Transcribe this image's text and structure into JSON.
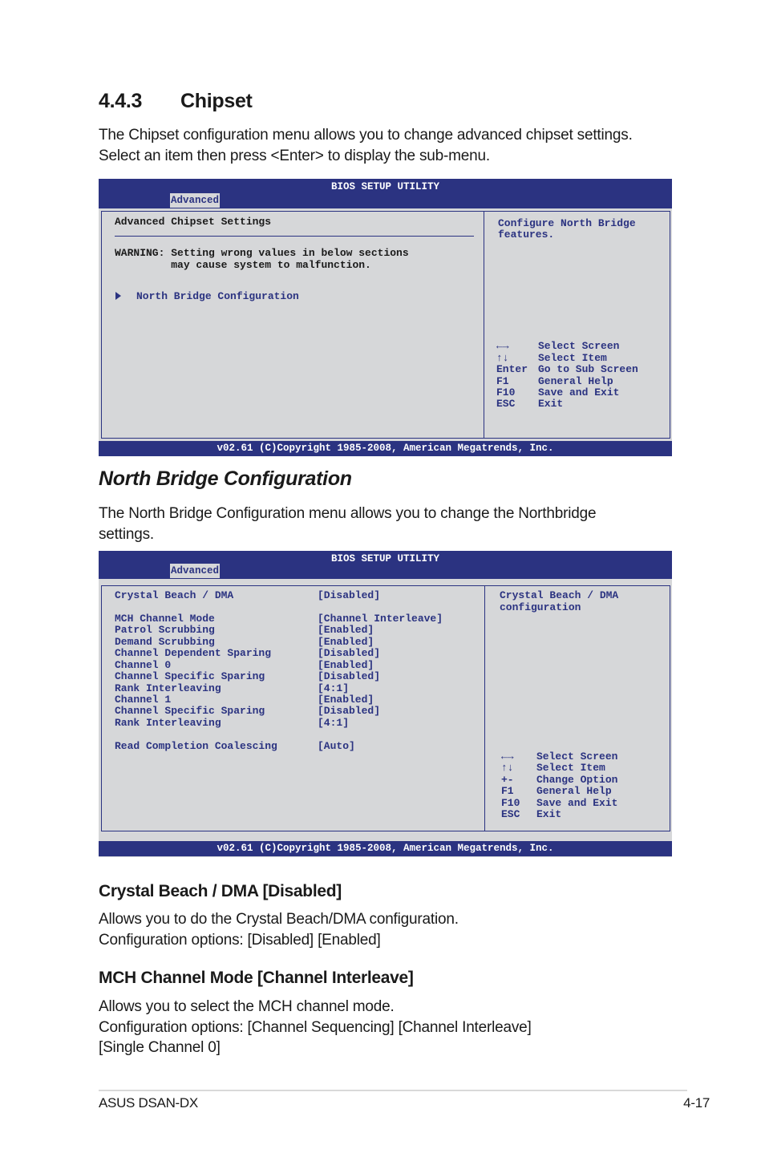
{
  "section": {
    "number": "4.4.3",
    "title": "Chipset"
  },
  "intro": {
    "line1": "The Chipset configuration menu allows you to change advanced chipset settings.",
    "line2": "Select an item then press <Enter> to display the sub-menu."
  },
  "bios1": {
    "title": "BIOS SETUP UTILITY",
    "tab": "Advanced",
    "heading": "Advanced Chipset Settings",
    "warning_line1": "WARNING: Setting wrong values in below sections",
    "warning_line2": "         may cause system to malfunction.",
    "submenu_item": "North Bridge Configuration",
    "help_line1": "Configure North Bridge",
    "help_line2": "features.",
    "keys": [
      {
        "key": "←→",
        "action": "Select Screen"
      },
      {
        "key": "↑↓",
        "action": "Select Item"
      },
      {
        "key": "Enter",
        "action": "Go to Sub Screen"
      },
      {
        "key": "F1",
        "action": "General Help"
      },
      {
        "key": "F10",
        "action": "Save and Exit"
      },
      {
        "key": "ESC",
        "action": "Exit"
      }
    ],
    "footer": "v02.61 (C)Copyright 1985-2008, American Megatrends, Inc."
  },
  "nb": {
    "title": "North Bridge Configuration",
    "desc_line1": "The North Bridge Configuration menu allows you to change the Northbridge",
    "desc_line2": "settings."
  },
  "bios2": {
    "title": "BIOS SETUP UTILITY",
    "tab": "Advanced",
    "settings": [
      {
        "label": "Crystal Beach / DMA",
        "value": "[Disabled]"
      },
      {
        "label": "MCH Channel Mode",
        "value": "[Channel Interleave]"
      },
      {
        "label": "Patrol Scrubbing",
        "value": "[Enabled]"
      },
      {
        "label": "Demand Scrubbing",
        "value": "[Enabled]"
      },
      {
        "label": "Channel Dependent Sparing",
        "value": "[Disabled]"
      },
      {
        "label": "Channel 0",
        "value": "[Enabled]"
      },
      {
        "label": "Channel Specific Sparing",
        "value": "[Disabled]"
      },
      {
        "label": "Rank Interleaving",
        "value": "[4:1]"
      },
      {
        "label": "Channel 1",
        "value": "[Enabled]"
      },
      {
        "label": "Channel Specific Sparing",
        "value": "[Disabled]"
      },
      {
        "label": "Rank Interleaving",
        "value": "[4:1]"
      },
      {
        "label": "Read Completion Coalescing",
        "value": "[Auto]"
      }
    ],
    "help_line1": "Crystal Beach / DMA",
    "help_line2": "configuration",
    "keys": [
      {
        "key": "←→",
        "action": "Select Screen"
      },
      {
        "key": "↑↓",
        "action": "Select Item"
      },
      {
        "key": "+-",
        "action": "Change Option"
      },
      {
        "key": "F1",
        "action": "General Help"
      },
      {
        "key": "F10",
        "action": "Save and Exit"
      },
      {
        "key": "ESC",
        "action": "Exit"
      }
    ],
    "footer": "v02.61 (C)Copyright 1985-2008, American Megatrends, Inc."
  },
  "crystal": {
    "title": "Crystal Beach / DMA [Disabled]",
    "line1": "Allows you to do the Crystal Beach/DMA configuration.",
    "line2": "Configuration options: [Disabled] [Enabled]"
  },
  "mch": {
    "title": "MCH Channel Mode [Channel Interleave]",
    "line1": "Allows you to select the MCH channel mode.",
    "line2": "Configuration options: [Channel Sequencing] [Channel Interleave]",
    "line3": "[Single Channel 0]"
  },
  "footer": {
    "product": "ASUS DSAN-DX",
    "page": "4-17"
  },
  "colors": {
    "bios_blue": "#2b3381",
    "bios_gray": "#d6d7d9"
  }
}
